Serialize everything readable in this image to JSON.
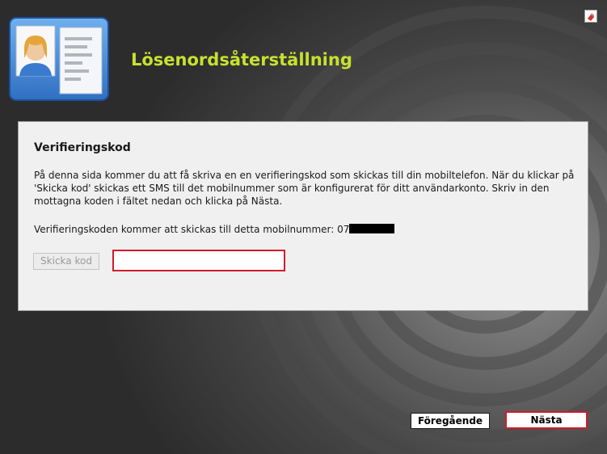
{
  "header": {
    "title": "Lösenordsåterställning",
    "icon": "id-card-icon",
    "help_icon": "help-icon"
  },
  "panel": {
    "heading": "Verifieringskod",
    "description": "På denna sida kommer du att få skriva en en verifieringskod som skickas till din mobiltelefon. När du klickar på 'Skicka kod' skickas ett SMS till det mobilnummer som är konfigurerat för ditt användarkonto. Skriv in den mottagna koden i fältet nedan och klicka på Nästa.",
    "phone_label": "Verifieringskoden kommer att skickas till detta mobilnummer: 07",
    "send_button_label": "Skicka kod",
    "code_input_value": "",
    "code_input_placeholder": ""
  },
  "nav": {
    "previous_label": "Föregående",
    "next_label": "Nästa"
  },
  "colors": {
    "title": "#c8e12e",
    "highlight_border": "#d21a2a",
    "panel_background": "#f0f0f0"
  }
}
